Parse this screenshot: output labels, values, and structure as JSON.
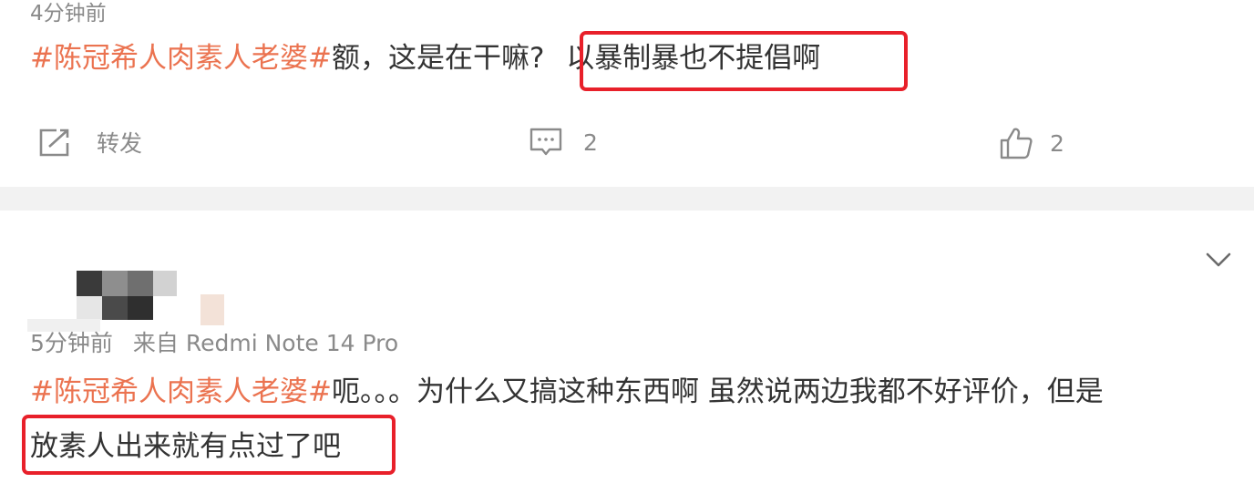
{
  "comment1": {
    "time": "4分钟前",
    "hashtag": "#陈冠希人肉素人老婆#",
    "text_before": "额，这是在干嘛? ",
    "text_highlight": "以暴制暴也不提倡啊",
    "actions": {
      "repost_label": "转发",
      "comment_count": "2",
      "like_count": "2"
    }
  },
  "comment2": {
    "time": "5分钟前",
    "source": "来自 Redmi Note 14 Pro",
    "hashtag": "#陈冠希人肉素人老婆#",
    "text_line1": "呃。。。为什么又搞这种东西啊 虽然说两边我都不好评价，但是",
    "text_highlight": "放素人出来就有点过了吧"
  },
  "colors": {
    "hashtag": "#eb7350",
    "highlight_border": "#e8202a",
    "meta": "#8a8a8a",
    "divider": "#f2f2f2"
  },
  "icons": [
    "repost-icon",
    "comment-icon",
    "like-icon",
    "chevron-down-icon"
  ]
}
